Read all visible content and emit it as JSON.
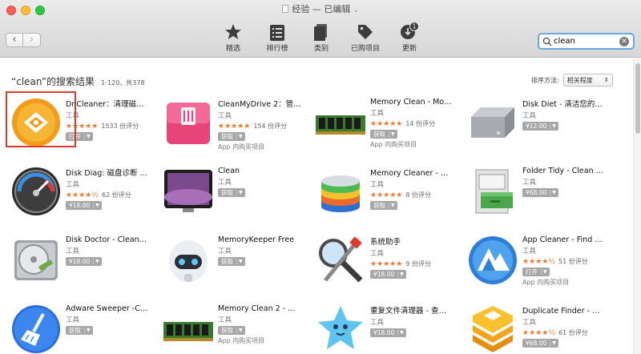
{
  "window": {
    "title": "经验 — 已编辑"
  },
  "toolbar": {
    "tabs": [
      {
        "label": "精选",
        "icon": "star-icon"
      },
      {
        "label": "排行榜",
        "icon": "list-icon"
      },
      {
        "label": "类别",
        "icon": "categories-icon"
      },
      {
        "label": "已购项目",
        "icon": "tag-icon"
      },
      {
        "label": "更新",
        "icon": "updates-icon",
        "badge": "1"
      }
    ],
    "search": {
      "value": "clean"
    }
  },
  "results": {
    "title": "“clean”的搜索结果",
    "count": "1-120，共378",
    "sort_label": "排序方法:",
    "sort_value": "相关程度"
  },
  "apps": [
    {
      "name": "Dr.Cleaner：清理磁盘和...",
      "category": "工具",
      "stars": "★★★★★",
      "rating_count": "1533 份评分",
      "button": "打开",
      "iap": "",
      "icon": "drcleaner-icon"
    },
    {
      "name": "Disk Diag: 磁盘诊断 - ...",
      "category": "工具",
      "stars": "★★★★½",
      "rating_count": "62 份评分",
      "button": "¥18.00",
      "iap": "",
      "icon": "disk-diag-icon"
    },
    {
      "name": "Disk Doctor - Clean Yo...",
      "category": "工具",
      "stars": "",
      "rating_count": "",
      "button": "¥18.00",
      "iap": "",
      "icon": "disk-doctor-icon"
    },
    {
      "name": "Adware Sweeper -Clea...",
      "category": "工具",
      "stars": "",
      "rating_count": "",
      "button": "获取",
      "iap": "",
      "icon": "adware-sweeper-icon"
    },
    {
      "name": "CleanMyDrive 2：管理...",
      "category": "工具",
      "stars": "★★★★★",
      "rating_count": "154 份评分",
      "button": "获取",
      "iap": "App 内购买项目",
      "icon": "cleanmydrive-icon"
    },
    {
      "name": "Clean",
      "category": "工具",
      "stars": "",
      "rating_count": "",
      "button": "获取",
      "iap": "",
      "icon": "clean-app-icon"
    },
    {
      "name": "MemoryKeeper Free",
      "category": "工具",
      "stars": "",
      "rating_count": "",
      "button": "获取",
      "iap": "",
      "icon": "memorykeeper-icon"
    },
    {
      "name": "Memory Clean 2 - Moni...",
      "category": "工具",
      "stars": "",
      "rating_count": "",
      "button": "获取",
      "iap": "App 内购买项目",
      "icon": "memory-clean-2-icon"
    },
    {
      "name": "Memory Clean - Monit...",
      "category": "工具",
      "stars": "★★★★★",
      "rating_count": "14 份评分",
      "button": "获取",
      "iap": "App 内购买项目",
      "icon": "memory-clean-icon"
    },
    {
      "name": "Memory Cleaner - 只需...",
      "category": "工具",
      "stars": "★★★★★",
      "rating_count": "8 份评分",
      "button": "获取",
      "iap": "",
      "icon": "memory-cleaner-icon"
    },
    {
      "name": "系统助手",
      "category": "工具",
      "stars": "★★★★★",
      "rating_count": "9 份评分",
      "button": "¥18.00",
      "iap": "",
      "icon": "system-assistant-icon"
    },
    {
      "name": "重复文件清理器 - 查找&...",
      "category": "工具",
      "stars": "",
      "rating_count": "",
      "button": "¥18.00",
      "iap": "",
      "icon": "duplicate-cleaner-icon"
    },
    {
      "name": "Disk Diet - 清洁您的硬...",
      "category": "工具",
      "stars": "",
      "rating_count": "",
      "button": "¥12.00",
      "iap": "",
      "icon": "disk-diet-icon"
    },
    {
      "name": "Folder Tidy - Clean up ...",
      "category": "工具",
      "stars": "",
      "rating_count": "",
      "button": "¥68.00",
      "iap": "",
      "icon": "folder-tidy-icon"
    },
    {
      "name": "App Cleaner - Find & R...",
      "category": "工具",
      "stars": "★★★★½",
      "rating_count": "51 份评分",
      "button": "打开",
      "iap": "App 内购买项目",
      "icon": "app-cleaner-icon"
    },
    {
      "name": "Duplicate Finder - 重复...",
      "category": "工具",
      "stars": "★★★★½",
      "rating_count": "61 份评分",
      "button": "¥68.00",
      "iap": "",
      "icon": "duplicate-finder-icon"
    }
  ],
  "colors": {
    "star": "#f2772b",
    "highlight": "#e0392e",
    "search_focus": "#6da6e6"
  }
}
